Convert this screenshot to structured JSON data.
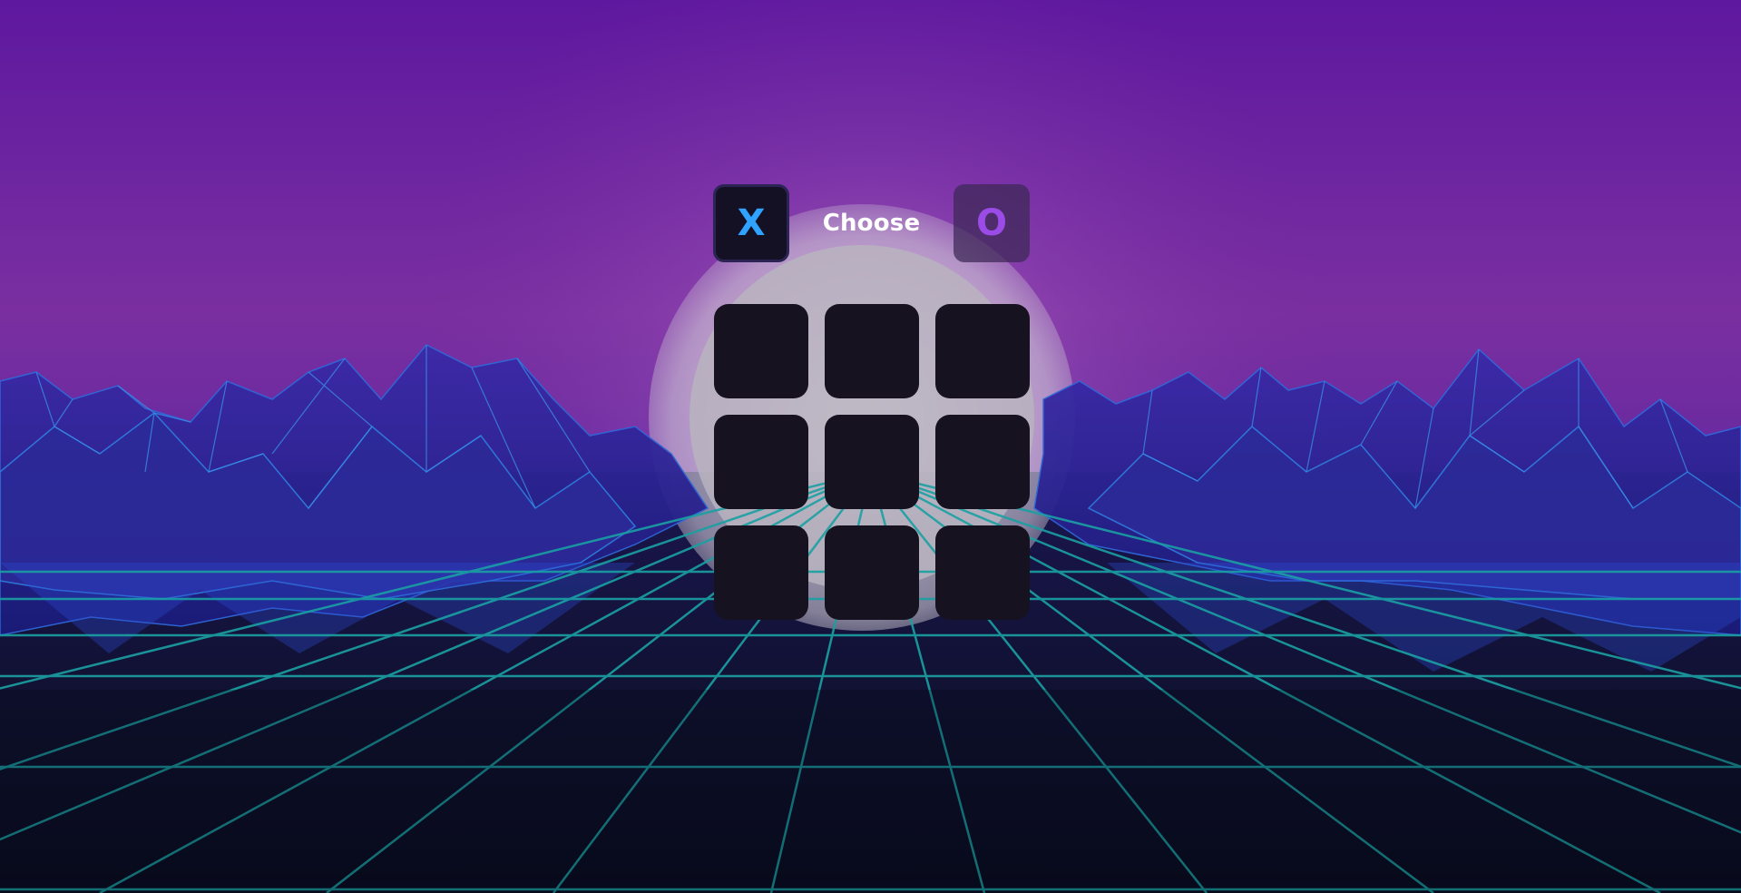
{
  "chooser": {
    "x_label": "X",
    "choose_label": "Choose",
    "o_label": "O"
  },
  "board": {
    "cells": [
      "",
      "",
      "",
      "",
      "",
      "",
      "",
      "",
      ""
    ]
  },
  "colors": {
    "x_color": "#2fa3ff",
    "o_color": "#9b4be6",
    "cell_bg": "#17121f",
    "sky_top": "#5e1aa0",
    "grid_line": "#1fa3a6"
  },
  "icons": {
    "background": "synthwave-landscape"
  }
}
